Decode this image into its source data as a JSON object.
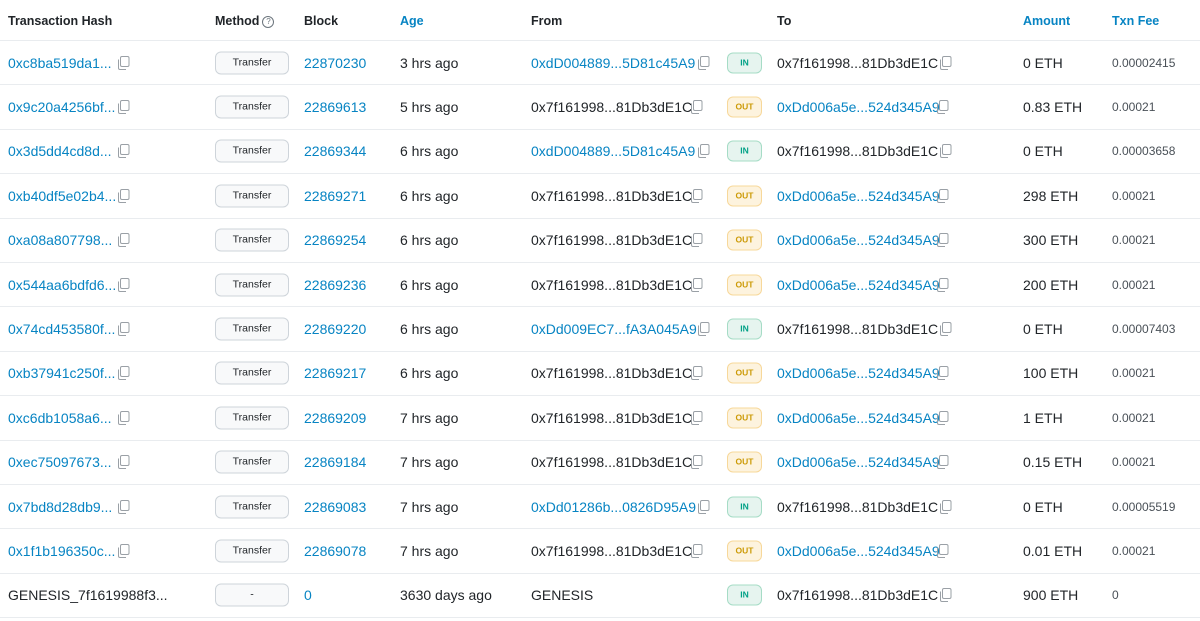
{
  "colors": {
    "link": "#0784c3",
    "in_bg": "#e6f4ef",
    "in_text": "#00a186",
    "out_bg": "#fdf3de",
    "out_text": "#cc9a06"
  },
  "header": {
    "hash": "Transaction Hash",
    "method": "Method",
    "method_help_icon": "?",
    "block": "Block",
    "age": "Age",
    "from": "From",
    "to": "To",
    "amount": "Amount",
    "fee": "Txn Fee"
  },
  "rows": [
    {
      "hash": "0xc8ba519da1...",
      "method": "Transfer",
      "block": "22870230",
      "age": "3 hrs ago",
      "from": "0xdD004889...5D81c45A9",
      "from_link": true,
      "dir": "IN",
      "to": "0x7f161998...81Db3dE1C",
      "to_link": false,
      "amount": "0 ETH",
      "fee": "0.00002415"
    },
    {
      "hash": "0x9c20a4256bf...",
      "method": "Transfer",
      "block": "22869613",
      "age": "5 hrs ago",
      "from": "0x7f161998...81Db3dE1C",
      "from_link": false,
      "dir": "OUT",
      "to": "0xDd006a5e...524d345A9",
      "to_link": true,
      "amount": "0.83 ETH",
      "fee": "0.00021"
    },
    {
      "hash": "0x3d5dd4cd8d...",
      "method": "Transfer",
      "block": "22869344",
      "age": "6 hrs ago",
      "from": "0xdD004889...5D81c45A9",
      "from_link": true,
      "dir": "IN",
      "to": "0x7f161998...81Db3dE1C",
      "to_link": false,
      "amount": "0 ETH",
      "fee": "0.00003658"
    },
    {
      "hash": "0xb40df5e02b4...",
      "method": "Transfer",
      "block": "22869271",
      "age": "6 hrs ago",
      "from": "0x7f161998...81Db3dE1C",
      "from_link": false,
      "dir": "OUT",
      "to": "0xDd006a5e...524d345A9",
      "to_link": true,
      "amount": "298 ETH",
      "fee": "0.00021"
    },
    {
      "hash": "0xa08a807798...",
      "method": "Transfer",
      "block": "22869254",
      "age": "6 hrs ago",
      "from": "0x7f161998...81Db3dE1C",
      "from_link": false,
      "dir": "OUT",
      "to": "0xDd006a5e...524d345A9",
      "to_link": true,
      "amount": "300 ETH",
      "fee": "0.00021"
    },
    {
      "hash": "0x544aa6bdfd6...",
      "method": "Transfer",
      "block": "22869236",
      "age": "6 hrs ago",
      "from": "0x7f161998...81Db3dE1C",
      "from_link": false,
      "dir": "OUT",
      "to": "0xDd006a5e...524d345A9",
      "to_link": true,
      "amount": "200 ETH",
      "fee": "0.00021"
    },
    {
      "hash": "0x74cd453580f...",
      "method": "Transfer",
      "block": "22869220",
      "age": "6 hrs ago",
      "from": "0xDd009EC7...fA3A045A9",
      "from_link": true,
      "dir": "IN",
      "to": "0x7f161998...81Db3dE1C",
      "to_link": false,
      "amount": "0 ETH",
      "fee": "0.00007403"
    },
    {
      "hash": "0xb37941c250f...",
      "method": "Transfer",
      "block": "22869217",
      "age": "6 hrs ago",
      "from": "0x7f161998...81Db3dE1C",
      "from_link": false,
      "dir": "OUT",
      "to": "0xDd006a5e...524d345A9",
      "to_link": true,
      "amount": "100 ETH",
      "fee": "0.00021"
    },
    {
      "hash": "0xc6db1058a6...",
      "method": "Transfer",
      "block": "22869209",
      "age": "7 hrs ago",
      "from": "0x7f161998...81Db3dE1C",
      "from_link": false,
      "dir": "OUT",
      "to": "0xDd006a5e...524d345A9",
      "to_link": true,
      "amount": "1 ETH",
      "fee": "0.00021"
    },
    {
      "hash": "0xec75097673...",
      "method": "Transfer",
      "block": "22869184",
      "age": "7 hrs ago",
      "from": "0x7f161998...81Db3dE1C",
      "from_link": false,
      "dir": "OUT",
      "to": "0xDd006a5e...524d345A9",
      "to_link": true,
      "amount": "0.15 ETH",
      "fee": "0.00021"
    },
    {
      "hash": "0x7bd8d28db9...",
      "method": "Transfer",
      "block": "22869083",
      "age": "7 hrs ago",
      "from": "0xDd01286b...0826D95A9",
      "from_link": true,
      "dir": "IN",
      "to": "0x7f161998...81Db3dE1C",
      "to_link": false,
      "amount": "0 ETH",
      "fee": "0.00005519"
    },
    {
      "hash": "0x1f1b196350c...",
      "method": "Transfer",
      "block": "22869078",
      "age": "7 hrs ago",
      "from": "0x7f161998...81Db3dE1C",
      "from_link": false,
      "dir": "OUT",
      "to": "0xDd006a5e...524d345A9",
      "to_link": true,
      "amount": "0.01 ETH",
      "fee": "0.00021"
    },
    {
      "hash": "GENESIS_7f1619988f3...",
      "hash_link": false,
      "method": "-",
      "block": "0",
      "age": "3630 days ago",
      "from": "GENESIS",
      "from_link": false,
      "from_copy": false,
      "dir": "IN",
      "to": "0x7f161998...81Db3dE1C",
      "to_link": false,
      "amount": "900 ETH",
      "fee": "0",
      "hash_copy": false
    }
  ]
}
